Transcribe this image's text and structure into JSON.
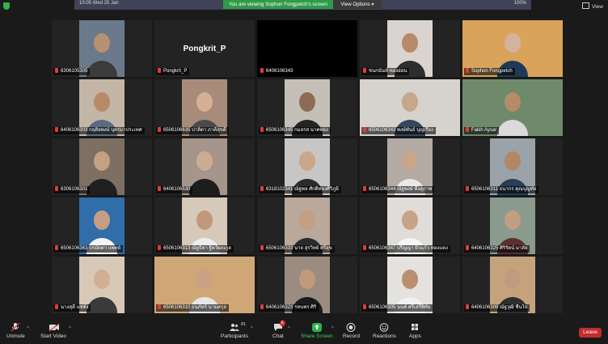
{
  "topbar": {
    "clock": "10:05   Wed 25 Jan",
    "status": "100%",
    "viewing_text": "You are viewing Sophon Fongpetch's screen",
    "view_options": "View Options",
    "view_label": "View"
  },
  "tiles": [
    {
      "name": "6306105305",
      "bg": "#6a7a8a",
      "skin": "#b89074",
      "shirt": "#3b3b3b"
    },
    {
      "name": "Pongkrit_P",
      "bg": "",
      "skin": "",
      "shirt": "",
      "video_off": true,
      "center_name": "Pongkrit_P"
    },
    {
      "name": "6406106343",
      "bg": "#000000",
      "skin": "",
      "shirt": "",
      "video_off": true,
      "center_name": ""
    },
    {
      "name": "ชนกนันท์ ทองอ่อน",
      "bg": "#d9d4cf",
      "skin": "#b88a6a",
      "shirt": "#2d2d2d"
    },
    {
      "name": "Sophon Fongpetch",
      "bg": "#d9a35a",
      "skin": "#d3b39c",
      "shirt": "#1f3a57",
      "active": true
    },
    {
      "name": "6406106303 กฤติยพงษ์ บุตรมาประเทศ",
      "bg": "#c4b6a6",
      "skin": "#b88a6a",
      "shirt": "#5b6a82"
    },
    {
      "name": "6506106635 ปาลิตา ภาคีสุขดี",
      "bg": "#a88b7a",
      "skin": "#d5b095",
      "shirt": "#4a4a4a"
    },
    {
      "name": "6506106345 กมลรส นาคทอง",
      "bg": "#c4c0b8",
      "skin": "#8e6b55",
      "shirt": "#242424"
    },
    {
      "name": "6506106343 พงษ์พันธ์ บุญเรือง",
      "bg": "#d6d2cc",
      "skin": "#c6a78c",
      "shirt": "#33485c"
    },
    {
      "name": "Fakih Aysar",
      "bg": "#6f8a6a",
      "skin": "#b58b6a",
      "shirt": "#dadada"
    },
    {
      "name": "6306106301",
      "bg": "#7d6f62",
      "skin": "#c6a083",
      "shirt": "#202020"
    },
    {
      "name": "6406106530",
      "bg": "#a5958a",
      "skin": "#ccac92",
      "shirt": "#1d1d1d"
    },
    {
      "name": "6318102341 ณัฐพล ศักดิ์ทองศิริภูมิ",
      "bg": "#c8c6c4",
      "skin": "#c9a78d",
      "shirt": "#2b2b2b"
    },
    {
      "name": "6506106344 ณัฐพงษ์ พึ่งสุภาพ",
      "bg": "#b2aaa3",
      "skin": "#c8a68a",
      "shirt": "#e8e8e8"
    },
    {
      "name": "6506106311 ธนากร คุณบุญทัย",
      "bg": "#9aa2aa",
      "skin": "#b38763",
      "shirt": "#2a3c56"
    },
    {
      "name": "6506106363 ปรมัตตา แพทย์",
      "bg": "#2f6ea8",
      "skin": "#c59f84",
      "shirt": "#f3f3f3"
    },
    {
      "name": "6506106313 ณัฐธิดา ฐิตวัฒนกุล",
      "bg": "#d7c9b9",
      "skin": "#c2987a",
      "shirt": "#ececec"
    },
    {
      "name": "6506106333 นาย สุรวิทย์ ศรีสุข",
      "bg": "#baa89a",
      "skin": "#c39f84",
      "shirt": "#2a2a2a"
    },
    {
      "name": "6506106347 ปริญญา ผิวแก้ว ทองแดง",
      "bg": "#e0dcd7",
      "skin": "#c7a488",
      "shirt": "#f5f5f5"
    },
    {
      "name": "6406106325 ศิริรัตน์ มาลัย",
      "bg": "#8a9a8c",
      "skin": "#c49e80",
      "shirt": "#5a2f2f"
    },
    {
      "name": "นางสุดี แซ่ตั้ง",
      "bg": "#d8c8b8",
      "skin": "#d2ae92",
      "shirt": "#3a3a3a"
    },
    {
      "name": "6506106310 ธนภัทร์ นามสกุล",
      "bg": "#cfa777",
      "skin": "#caa283",
      "shirt": "#e6e6e6"
    },
    {
      "name": "6406106323 รทนพร ศิริ",
      "bg": "#9a8c80",
      "skin": "#c29a7b",
      "shirt": "#1b1b1b"
    },
    {
      "name": "6506106305 นนท์ ศรีเสรีพิทัย",
      "bg": "#e4e2df",
      "skin": "#b98f6f",
      "shirt": "#f0f0f0"
    },
    {
      "name": "6406106309 ณัฐวุฒิ ชื่นใจ",
      "bg": "#c4a37c",
      "skin": "#c29a7d",
      "shirt": "#2e2e2e"
    }
  ],
  "toolbar": {
    "unmute": "Unmute",
    "start_video": "Start Video",
    "participants": "Participants",
    "participants_count": "81",
    "chat": "Chat",
    "chat_badge": "6",
    "share_screen": "Share Screen",
    "record": "Record",
    "reactions": "Reactions",
    "apps": "Apps",
    "leave": "Leave"
  },
  "colors": {
    "accent_green": "#2eb24f",
    "active_border": "#9ccc3c",
    "leave_red": "#c42b2b",
    "mic_red": "#e23b3b"
  }
}
